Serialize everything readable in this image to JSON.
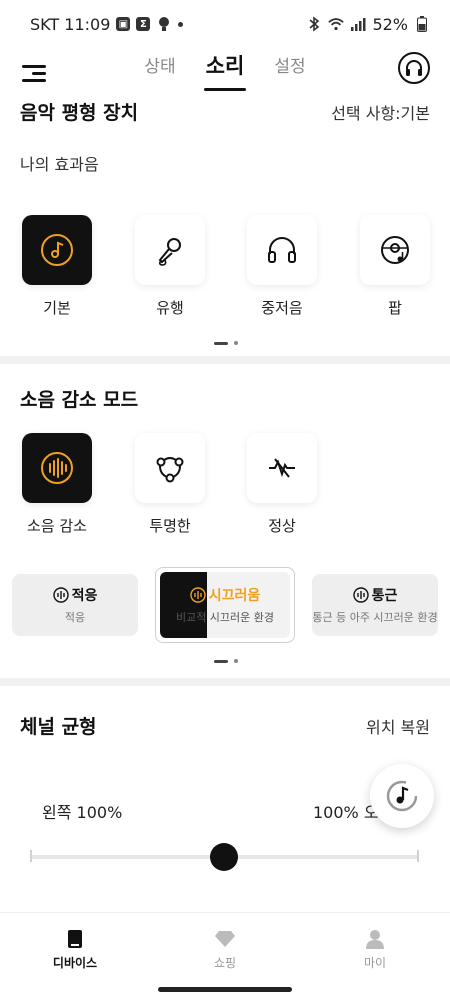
{
  "status_bar": {
    "carrier_time": "SKT 11:09",
    "battery": "52%"
  },
  "tabs": [
    {
      "label": "상태",
      "active": false
    },
    {
      "label": "소리",
      "active": true
    },
    {
      "label": "설정",
      "active": false
    }
  ],
  "eq": {
    "title": "음악 평형 장치",
    "selection": "선택 사항:기본",
    "subtitle": "나의 효과음",
    "presets": [
      {
        "label": "기본",
        "icon": "music-disc-icon",
        "selected": true
      },
      {
        "label": "유행",
        "icon": "microphone-icon",
        "selected": false
      },
      {
        "label": "중저음",
        "icon": "headphones-icon",
        "selected": false
      },
      {
        "label": "팝",
        "icon": "pop-disc-icon",
        "selected": false
      }
    ]
  },
  "noise": {
    "title": "소음 감소 모드",
    "modes": [
      {
        "label": "소음 감소",
        "icon": "noise-cancel-icon",
        "selected": true
      },
      {
        "label": "투명한",
        "icon": "transparency-icon",
        "selected": false
      },
      {
        "label": "정상",
        "icon": "normal-off-icon",
        "selected": false
      }
    ],
    "levels": [
      {
        "title": "적응",
        "subtitle": "적응"
      },
      {
        "title": "시끄러움",
        "subtitle": "비교적 시끄러운 환경",
        "selected": true
      },
      {
        "title": "통근",
        "subtitle": "통근 등 아주 시끄러운 환경"
      }
    ]
  },
  "balance": {
    "title": "체널 균형",
    "reset": "위치 복원",
    "left": "왼쪽 100%",
    "right": "100% 오",
    "value": 0.5
  },
  "bottom_nav": [
    {
      "label": "디바이스",
      "active": true
    },
    {
      "label": "쇼핑",
      "active": false
    },
    {
      "label": "마이",
      "active": false
    }
  ],
  "colors": {
    "accent": "#f0a020",
    "dark": "#111111"
  }
}
